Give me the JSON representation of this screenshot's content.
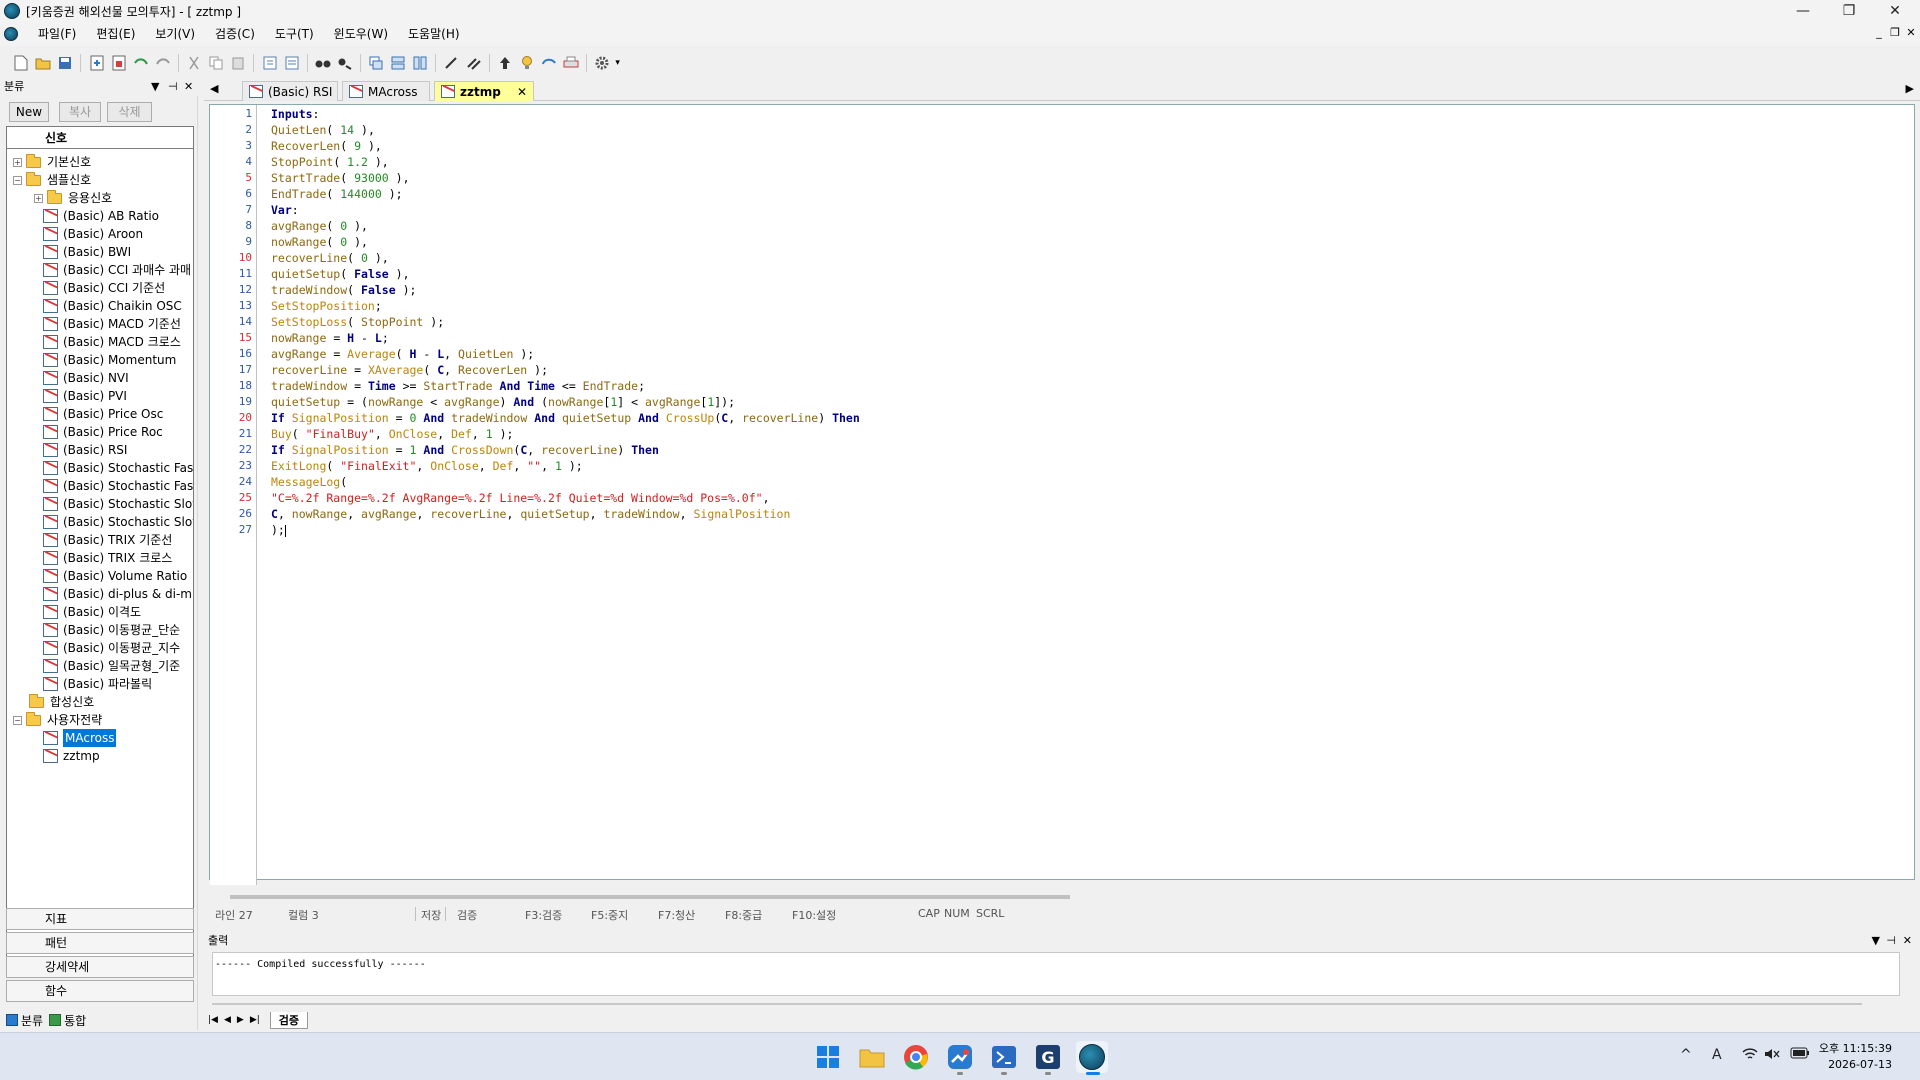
{
  "window": {
    "title": "[키움증권 해외선물 모의투자] - [ zztmp    ]"
  },
  "menu": [
    "파일(F)",
    "편집(E)",
    "보기(V)",
    "검증(C)",
    "도구(T)",
    "윈도우(W)",
    "도움말(H)"
  ],
  "left_panel": {
    "header": "분류",
    "buttons": {
      "new": "New",
      "copy": "복사",
      "delete": "삭제"
    },
    "tree_header": "신호",
    "folders": {
      "basic": "기본신호",
      "sample": "샘플신호",
      "applied": "응용신호",
      "composite": "합성신호",
      "user": "사용자전략"
    },
    "sample_items": [
      "(Basic) AB Ratio",
      "(Basic) Aroon",
      "(Basic) BWI",
      "(Basic) CCI 과매수 과매",
      "(Basic) CCI 기준선",
      "(Basic) Chaikin OSC",
      "(Basic) MACD 기준선",
      "(Basic) MACD 크로스",
      "(Basic) Momentum",
      "(Basic) NVI",
      "(Basic) PVI",
      "(Basic) Price Osc",
      "(Basic) Price Roc",
      "(Basic) RSI",
      "(Basic) Stochastic Fast",
      "(Basic) Stochastic Fast",
      "(Basic) Stochastic Slow",
      "(Basic) Stochastic Slow",
      "(Basic) TRIX 기준선",
      "(Basic) TRIX 크로스",
      "(Basic) Volume Ratio",
      "(Basic) di-plus & di-m",
      "(Basic) 이격도",
      "(Basic) 이동평균_단순",
      "(Basic) 이동평균_지수",
      "(Basic) 일목균형_기준",
      "(Basic) 파라볼릭"
    ],
    "user_items": [
      "MAcross",
      "zztmp"
    ],
    "bottom_tabs": [
      "지표",
      "패턴",
      "강세약세",
      "함수"
    ],
    "footer_tabs": [
      "분류",
      "통합"
    ]
  },
  "doc_tabs": [
    "(Basic) RSI",
    "MAcross",
    "zztmp"
  ],
  "code_lines": [
    "Inputs:",
    "QuietLen( 14 ),",
    "RecoverLen( 9 ),",
    "StopPoint( 1.2 ),",
    "StartTrade( 93000 ),",
    "EndTrade( 144000 );",
    "Var:",
    "avgRange( 0 ),",
    "nowRange( 0 ),",
    "recoverLine( 0 ),",
    "quietSetup( False ),",
    "tradeWindow( False );",
    "SetStopPosition;",
    "SetStopLoss( StopPoint );",
    "nowRange = H - L;",
    "avgRange = Average( H - L, QuietLen );",
    "recoverLine = XAverage( C, RecoverLen );",
    "tradeWindow = Time >= StartTrade And Time <= EndTrade;",
    "quietSetup = (nowRange < avgRange) And (nowRange[1] < avgRange[1]);",
    "If SignalPosition = 0 And tradeWindow And quietSetup And CrossUp(C, recoverLine) Then",
    "Buy( \"FinalBuy\", OnClose, Def, 1 );",
    "If SignalPosition = 1 And CrossDown(C, recoverLine) Then",
    "ExitLong( \"FinalExit\", OnClose, Def, \"\", 1 );",
    "MessageLog(",
    "\"C=%.2f Range=%.2f AvgRange=%.2f Line=%.2f Quiet=%d Window=%d Pos=%.0f\",",
    "C, nowRange, avgRange, recoverLine, quietSetup, tradeWindow, SignalPosition",
    ");"
  ],
  "line_numbers": [
    "1",
    "2",
    "3",
    "4",
    "5",
    "6",
    "7",
    "8",
    "9",
    "10",
    "11",
    "12",
    "13",
    "14",
    "15",
    "16",
    "17",
    "18",
    "19",
    "20",
    "21",
    "22",
    "23",
    "24",
    "25",
    "26",
    "27"
  ],
  "status": {
    "line": "라인 27",
    "column": "컬럼 3",
    "save": "저장",
    "verify": "검증",
    "f3": "F3:검증",
    "f5": "F5:중지",
    "f7": "F7:청산",
    "f8": "F8:중급",
    "f10": "F10:설정",
    "cap": "CAP",
    "num": "NUM",
    "scrl": "SCRL"
  },
  "output": {
    "header": "출력",
    "message": "------ Compiled successfully ------",
    "tab": "검증"
  },
  "taskbar": {
    "time": "오후 11:15:39",
    "date": "2026-07-13",
    "ime": "A"
  }
}
